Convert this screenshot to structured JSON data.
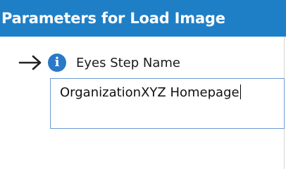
{
  "panel": {
    "title": "Parameters for Load Image"
  },
  "parameter": {
    "label": "Eyes Step Name",
    "value": "OrganizationXYZ Homepage",
    "icons": {
      "pointer": "arrow-right-icon",
      "info": "info-icon"
    }
  },
  "colors": {
    "header_bg": "#1f7fc6",
    "header_text": "#ffffff",
    "info_icon_bg": "#2a78c8",
    "input_border": "#6b9bd1"
  }
}
